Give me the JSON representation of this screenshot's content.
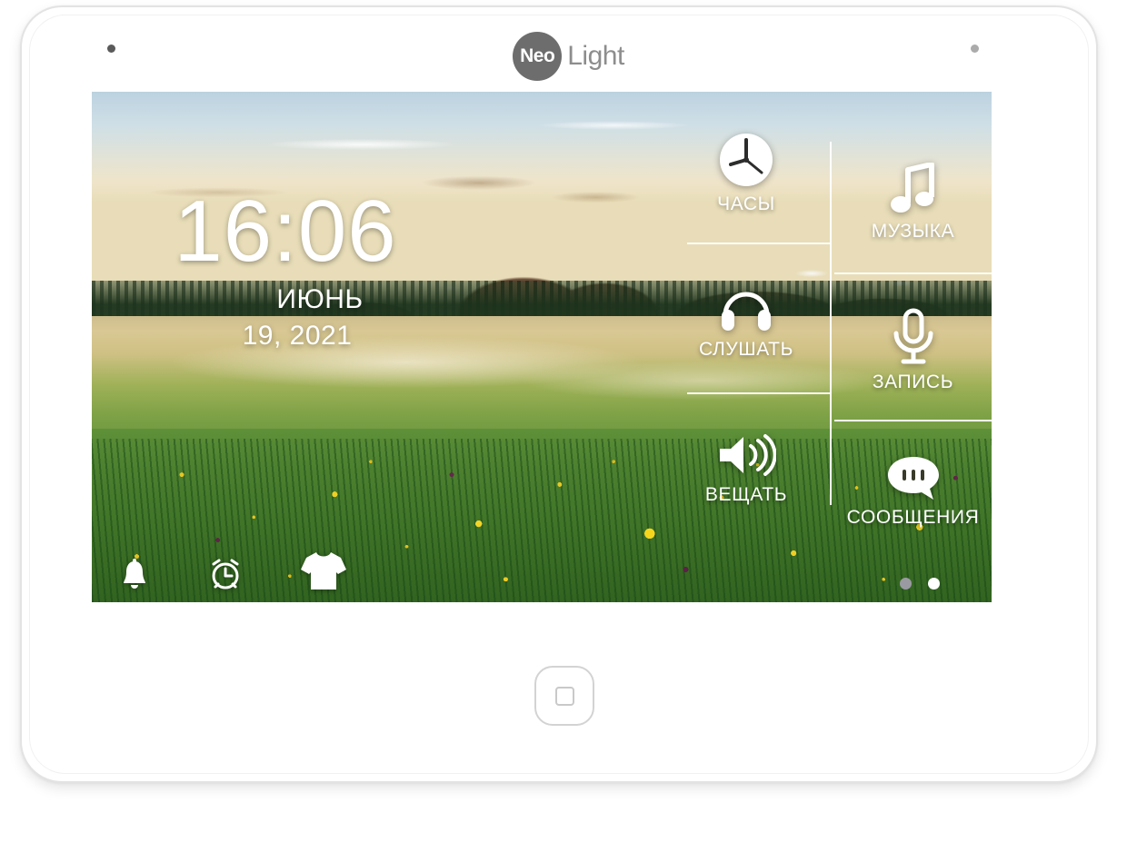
{
  "device": {
    "brand_mark": "Neo",
    "brand_word": "Light",
    "sensor_left": "sensor-dot-left",
    "sensor_right": "sensor-dot-right",
    "home_button_label": "Home"
  },
  "clock": {
    "time": "16:06",
    "month": "ИЮНЬ",
    "date": "19, 2021"
  },
  "menu": {
    "middle_column": [
      {
        "label": "ЧАСЫ",
        "icon": "clock-icon"
      },
      {
        "label": "СЛУШАТЬ",
        "icon": "headphones-icon"
      },
      {
        "label": "ВЕЩАТЬ",
        "icon": "speaker-broadcast-icon"
      }
    ],
    "right_column": [
      {
        "label": "МУЗЫКА",
        "icon": "music-note-icon"
      },
      {
        "label": "ЗАПИСЬ",
        "icon": "microphone-icon"
      },
      {
        "label": "СООБЩЕНИЯ",
        "icon": "speech-bubble-icon"
      }
    ]
  },
  "statusbar": {
    "icons": [
      {
        "name": "bell-icon",
        "label": "Уведомления"
      },
      {
        "name": "alarm-clock-icon",
        "label": "Будильник"
      },
      {
        "name": "theme-shirt-icon",
        "label": "Тема"
      }
    ],
    "page_dots": [
      {
        "state": "inactive"
      },
      {
        "state": "active"
      }
    ]
  },
  "colors": {
    "brand_gray": "#6d6d6d",
    "brand_word_gray": "#8d8d8d",
    "bezel_white": "#ffffff",
    "divider_white": "#ffffff",
    "dot_active": "#ffffff",
    "dot_inactive": "#9a9aa2"
  }
}
